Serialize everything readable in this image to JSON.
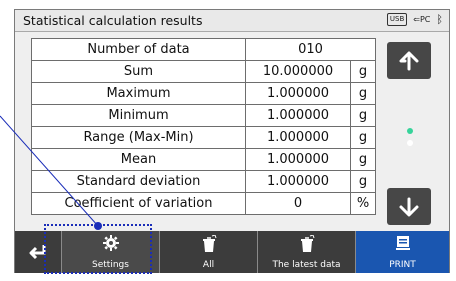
{
  "title": "Statistical calculation results",
  "status": {
    "usb": "USB",
    "pc": "PC"
  },
  "rows": [
    {
      "label": "Number of data",
      "value": "010",
      "unit": ""
    },
    {
      "label": "Sum",
      "value": "10.000000",
      "unit": "g"
    },
    {
      "label": "Maximum",
      "value": "1.000000",
      "unit": "g"
    },
    {
      "label": "Minimum",
      "value": "1.000000",
      "unit": "g"
    },
    {
      "label": "Range (Max-Min)",
      "value": "1.000000",
      "unit": "g"
    },
    {
      "label": "Mean",
      "value": "1.000000",
      "unit": "g"
    },
    {
      "label": "Standard deviation",
      "value": "1.000000",
      "unit": "g"
    },
    {
      "label": "Coefficient of variation",
      "value": "0",
      "unit": "%"
    }
  ],
  "page_indicator": {
    "current": 1,
    "total": 2,
    "active_color": "#36d39a",
    "inactive_color": "#ffffff"
  },
  "toolbar": {
    "back_icon": "return-arrow-icon",
    "settings_label": "Settings",
    "all_label": "All",
    "latest_label": "The latest data",
    "print_label": "PRINT"
  },
  "colors": {
    "print_button": "#1a56b0",
    "toolbar_bg": "#3c3c3c",
    "highlight": "#1a2db8"
  }
}
